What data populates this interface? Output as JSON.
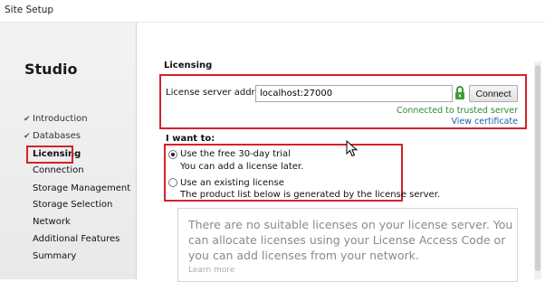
{
  "window": {
    "title": "Site Setup"
  },
  "sidebar": {
    "brand": "Studio",
    "items": [
      {
        "label": "Introduction",
        "state": "done"
      },
      {
        "label": "Databases",
        "state": "done"
      },
      {
        "label": "Licensing",
        "state": "active"
      },
      {
        "label": "Connection",
        "state": "pending"
      },
      {
        "label": "Storage Management",
        "state": "pending"
      },
      {
        "label": "Storage Selection",
        "state": "pending"
      },
      {
        "label": "Network",
        "state": "pending"
      },
      {
        "label": "Additional Features",
        "state": "pending"
      },
      {
        "label": "Summary",
        "state": "pending"
      }
    ]
  },
  "licensing": {
    "title": "Licensing",
    "server_label": "License server address:",
    "server_value": "localhost:27000",
    "connect_label": "Connect",
    "status": "Connected to trusted server",
    "view_certificate": "View certificate",
    "lock_icon": "lock-icon",
    "status_color": "#2f8a2f",
    "link_color": "#1e5fb4",
    "highlight_color": "#d2232a"
  },
  "options": {
    "title": "I want to:",
    "trial": {
      "label": "Use the free 30-day trial",
      "desc": "You can add a license later.",
      "selected": true
    },
    "existing": {
      "label": "Use an existing license",
      "desc": "The product list below is generated by the license server.",
      "selected": false
    }
  },
  "notice": {
    "text": "There are no suitable licenses on your license server. You can allocate licenses using your License Access Code or you can add licenses from your network.",
    "learn_more": "Learn more"
  }
}
